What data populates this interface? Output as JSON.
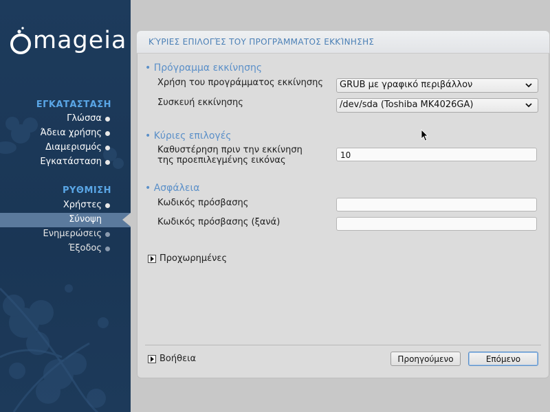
{
  "brand": {
    "name": "mageia"
  },
  "sidebar": {
    "sections": [
      {
        "title": "ΕΓΚΑΤΑΣΤΑΣΗ",
        "items": [
          {
            "label": "Γλώσσα",
            "state": "done"
          },
          {
            "label": "Άδεια χρήσης",
            "state": "done"
          },
          {
            "label": "Διαμερισμός",
            "state": "done"
          },
          {
            "label": "Εγκατάσταση",
            "state": "done"
          }
        ]
      },
      {
        "title": "ΡΥΘΜΙΣΗ",
        "items": [
          {
            "label": "Χρήστες",
            "state": "done"
          },
          {
            "label": "Σύνοψη",
            "state": "active"
          },
          {
            "label": "Ενημερώσεις",
            "state": "pending"
          },
          {
            "label": "Έξοδος",
            "state": "pending"
          }
        ]
      }
    ]
  },
  "panel": {
    "title": "ΚΎΡΙΕΣ ΕΠΙΛΟΓΈΣ ΤΟΥ ΠΡΟΓΡΆΜΜΑΤΟΣ ΕΚΚΊΝΗΣΗΣ",
    "bootloader": {
      "group_title": "• Πρόγραμμα εκκίνησης",
      "use_label": "Χρήση του προγράμματος εκκίνησης",
      "use_value": "GRUB με γραφικό περιβάλλον",
      "device_label": "Συσκευή εκκίνησης",
      "device_value": "/dev/sda (Toshiba MK4026GA)"
    },
    "main_options": {
      "group_title": "• Κύριες επιλογές",
      "delay_label_line1": "Καθυστέρηση πριν την εκκίνηση",
      "delay_label_line2": "της προεπιλεγμένης εικόνας",
      "delay_value": "10"
    },
    "security": {
      "group_title": "• Ασφάλεια",
      "password_label": "Κωδικός πρόσβασης",
      "password_value": "",
      "password_again_label": "Κωδικός πρόσβασης (ξανά)",
      "password_again_value": ""
    },
    "advanced_label": "Προχωρημένες",
    "help_label": "Βοήθεια",
    "previous_label": "Προηγούμενο",
    "next_label": "Επόμενο"
  },
  "colors": {
    "sidebar_bg": "#1d3b5c",
    "accent": "#5a8fc8",
    "section_title": "#5aa6e6",
    "active_item": "#5b7a9d"
  },
  "icons": {
    "logo": "mageia-swirl-icon",
    "combo_arrow": "chevron-down-icon",
    "expander": "triangle-right-icon",
    "pointer": "mouse-pointer-icon"
  }
}
